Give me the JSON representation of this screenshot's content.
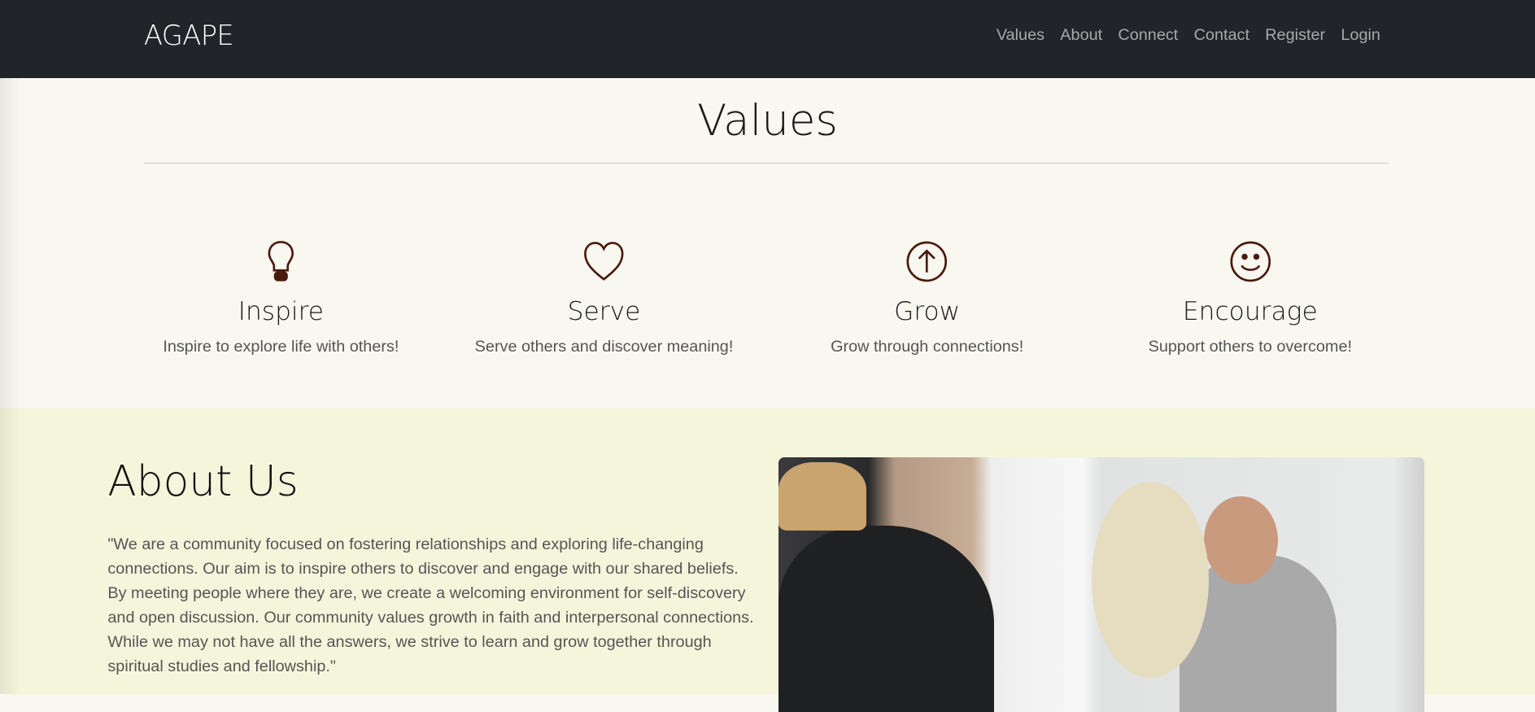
{
  "nav": {
    "brand": "AGAPE",
    "links": [
      "Values",
      "About",
      "Connect",
      "Contact",
      "Register",
      "Login"
    ]
  },
  "values": {
    "title": "Values",
    "items": [
      {
        "icon": "lightbulb-icon",
        "title": "Inspire",
        "text": "Inspire to explore life with others!"
      },
      {
        "icon": "heart-icon",
        "title": "Serve",
        "text": "Serve others and discover meaning!"
      },
      {
        "icon": "arrow-up-circle-icon",
        "title": "Grow",
        "text": "Grow through connections!"
      },
      {
        "icon": "smile-icon",
        "title": "Encourage",
        "text": "Support others to overcome!"
      }
    ],
    "icon_color": "#4a1a0e"
  },
  "about": {
    "title": "About Us",
    "text": "\"We are a community focused on fostering relationships and exploring life-changing connections. Our aim is to inspire others to discover and engage with our shared beliefs. By meeting people where they are, we create a welcoming environment for self-discovery and open discussion. Our community values growth in faith and interpersonal connections. While we may not have all the answers, we strive to learn and grow together through spiritual studies and fellowship.\""
  }
}
